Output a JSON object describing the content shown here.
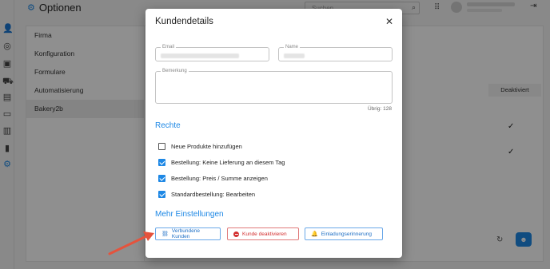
{
  "app": {
    "title": "Optionen",
    "search_placeholder": "Suchen",
    "nav": [
      "Firma",
      "Konfiguration",
      "Formulare",
      "Automatisierung",
      "Bakery2b"
    ],
    "table_header": "Deaktiviert"
  },
  "dialog": {
    "title": "Kundendetails",
    "email_label": "Email",
    "name_label": "Name",
    "remark_label": "Bemerkung",
    "remaining": "Übrig: 128",
    "rights_title": "Rechte",
    "checkboxes": [
      {
        "label": "Neue Produkte hinzufügen",
        "checked": false
      },
      {
        "label": "Bestellung: Keine Lieferung an diesem Tag",
        "checked": true
      },
      {
        "label": "Bestellung: Preis / Summe anzeigen",
        "checked": true
      },
      {
        "label": "Standardbestellung: Bearbeiten",
        "checked": true
      }
    ],
    "more_title": "Mehr Einstellungen",
    "buttons": {
      "linked": "Verbundene Kunden",
      "deactivate": "Kunde deaktivieren",
      "invite": "Einladungserinnerung"
    }
  },
  "colors": {
    "accent": "#1e88e5",
    "danger": "#d32f2f",
    "annotation_arrow": "#e5533d"
  }
}
